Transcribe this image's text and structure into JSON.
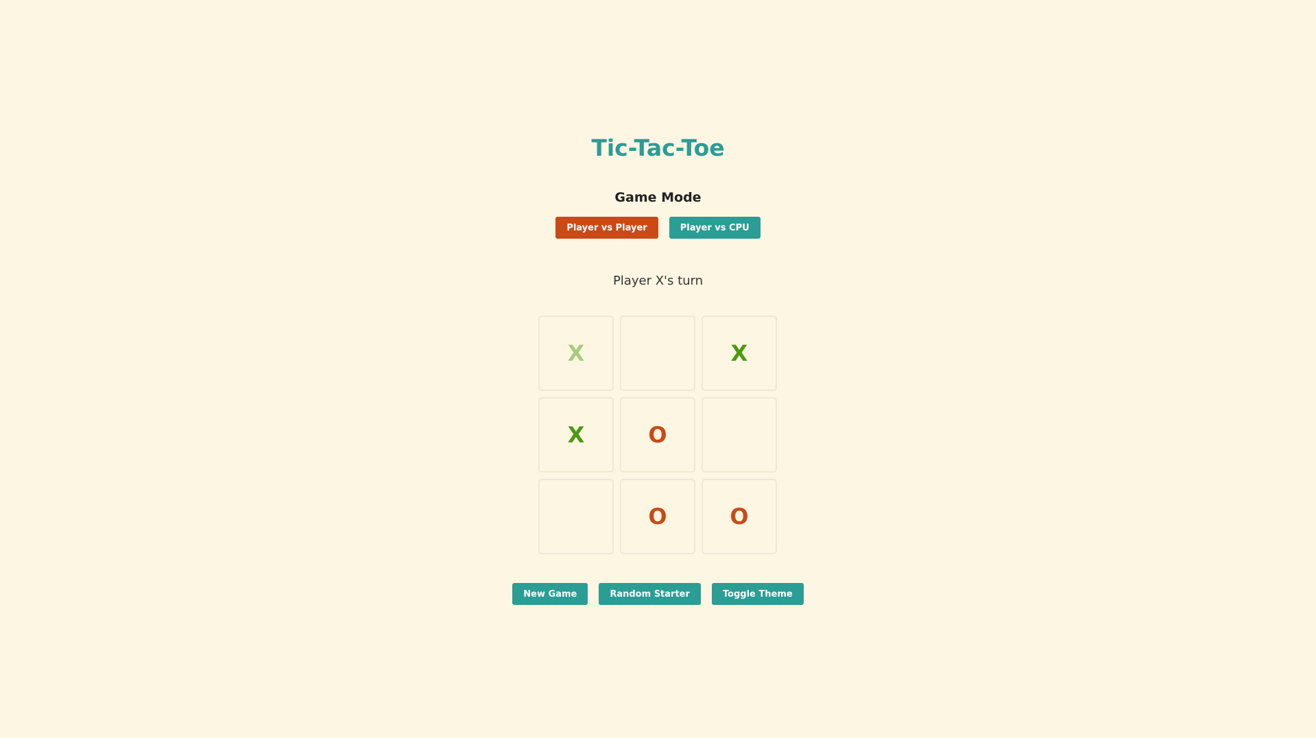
{
  "title": "Tic-Tac-Toe",
  "mode": {
    "label": "Game Mode",
    "options": [
      {
        "label": "Player vs Player",
        "active": true
      },
      {
        "label": "Player vs CPU",
        "active": false
      }
    ]
  },
  "status": "Player X's turn",
  "board": {
    "cells": [
      {
        "mark": "X",
        "faded": true
      },
      {
        "mark": "",
        "faded": false
      },
      {
        "mark": "X",
        "faded": false
      },
      {
        "mark": "X",
        "faded": false
      },
      {
        "mark": "O",
        "faded": false
      },
      {
        "mark": "",
        "faded": false
      },
      {
        "mark": "",
        "faded": false
      },
      {
        "mark": "O",
        "faded": false
      },
      {
        "mark": "O",
        "faded": false
      }
    ]
  },
  "controls": {
    "new_game": "New Game",
    "random_starter": "Random Starter",
    "toggle_theme": "Toggle Theme"
  },
  "colors": {
    "background": "#fdf6e3",
    "accent": "#2a9d95",
    "active_button": "#c94a17",
    "x_mark": "#4a9a12",
    "x_mark_faded": "#a6cc7c",
    "o_mark": "#c94a17"
  }
}
